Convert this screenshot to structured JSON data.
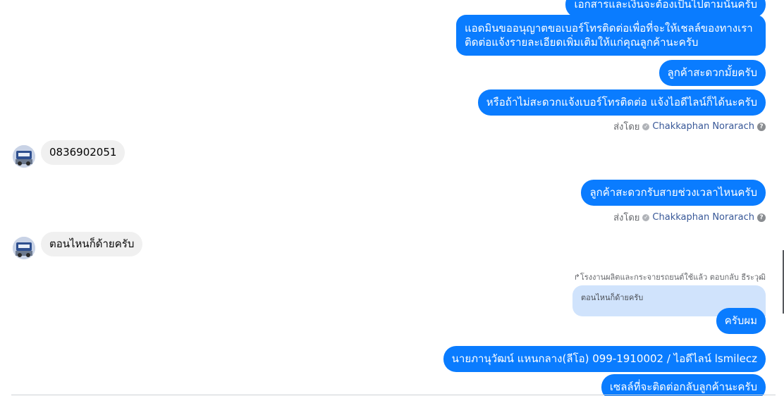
{
  "messages": {
    "m0": "เอกสารและเงินจะต้องเป็นไปตามนั้นครับ",
    "m1": "แอดมินขออนุญาตขอเบอร์โทรติดต่อเพื่อที่จะให้เชลล์ของทางเรา ติดต่อแจ้งรายละเอียดเพิ่มเติมให้แก่คุณลูกค้านะครับ",
    "m2": "ลูกค้าสะดวกมั้ยครับ",
    "m3": "หรือถ้าไม่สะดวกแจ้งเบอร์โทรติดต่อ แจ้งไอดีไลน์ก็ได้นะครับ",
    "in1": "0836902051",
    "m4": "ลูกค้าสะดวกรับสายช่วงเวลาไหนครับ",
    "in2": "ตอนไหนก็ด้ายครับ",
    "reply_meta": "↱โรงงานผลิตและกระจายรถยนต์ใช้แล้ว ตอบกลับ ธีระวุฒิ",
    "quoted": "ตอนไหนก็ด้ายครับ",
    "m5": "ครับผม",
    "m6": "นายภานุวัฒน์ แหนกลาง(ลีโอ)        099-1910002 / ไอดีไลน์ lsmilecz",
    "m7": "เซลล์ที่จะติดต่อกลับลูกค้านะครับ"
  },
  "sender": {
    "prefix": "ส่งโดย",
    "name": "Chakkaphan Norarach",
    "check_icon": "✓",
    "help_icon": "?"
  },
  "colors": {
    "outgoing": "#0a7cff",
    "incoming": "#f0f0f0",
    "quoted": "#d0e3fc"
  }
}
